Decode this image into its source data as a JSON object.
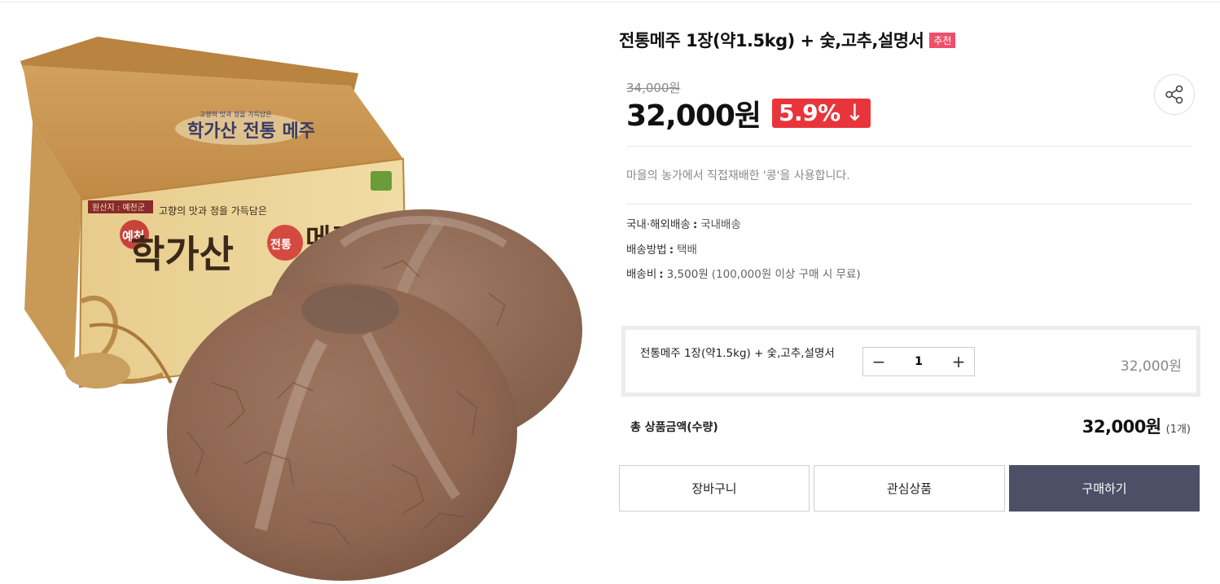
{
  "product": {
    "title": "전통메주 1장(약1.5kg) + 숯,고추,설명서",
    "badge": "추천",
    "original_price": "34,000원",
    "sale_price": "32,000원",
    "discount": "5.9%",
    "discount_arrow": "↓",
    "description": "마을의 농가에서 직접재배한 '콩'을 사용합니다."
  },
  "image": {
    "box_origin": "원산지 : 예천군",
    "box_slogan": "고향의 맛과 정을 가득담은",
    "box_brand": "학가산",
    "box_brand_mark": "전통",
    "box_product": "메주",
    "box_region": "예천",
    "box_top_line": "고향의 맛과 정을 가득담은",
    "box_top_brand": "학가산 전통 메주"
  },
  "shipping": [
    {
      "label": "국내·해외배송",
      "value": "국내배송",
      "note": ""
    },
    {
      "label": "배송방법",
      "value": "택배",
      "note": ""
    },
    {
      "label": "배송비",
      "value": "3,500원",
      "note": "(100,000원 이상 구매 시 무료)"
    }
  ],
  "option": {
    "name": "전통메주 1장(약1.5kg) + 숯,고추,설명서",
    "quantity": "1",
    "price": "32,000원",
    "minus": "−",
    "plus": "+"
  },
  "total": {
    "label": "총 상품금액(수량)",
    "price": "32,000원",
    "qty": "(1개)"
  },
  "buttons": {
    "cart": "장바구니",
    "wishlist": "관심상품",
    "buy": "구매하기"
  },
  "icons": {
    "share": "share-icon"
  },
  "colors": {
    "badge_pink": "#ef4f6b",
    "discount_red": "#e8353c",
    "buy_button": "#4c5066"
  }
}
